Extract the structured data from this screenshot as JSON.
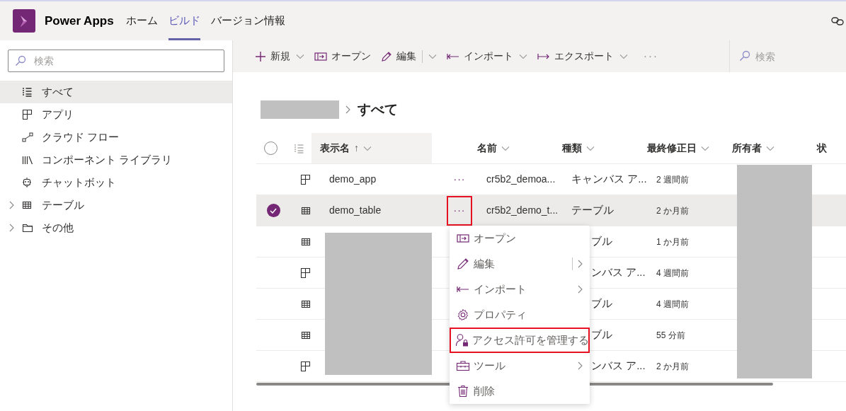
{
  "app": {
    "title": "Power Apps"
  },
  "nav_tabs": [
    {
      "label": "ホーム",
      "selected": false
    },
    {
      "label": "ビルド",
      "selected": true
    },
    {
      "label": "バージョン情報",
      "selected": false
    }
  ],
  "sidebar": {
    "search": {
      "placeholder": "検索"
    },
    "items": [
      {
        "label": "すべて",
        "selected": true
      },
      {
        "label": "アプリ",
        "selected": false
      },
      {
        "label": "クラウド フロー",
        "selected": false
      },
      {
        "label": "コンポーネント ライブラリ",
        "selected": false
      },
      {
        "label": "チャットボット",
        "selected": false
      },
      {
        "label": "テーブル",
        "selected": false,
        "expanded": false
      },
      {
        "label": "その他",
        "selected": false,
        "expanded": false
      }
    ]
  },
  "toolbar": {
    "items": [
      {
        "label": "新規",
        "dropdown": true
      },
      {
        "label": "オープン",
        "dropdown": false
      },
      {
        "label": "編集",
        "dropdown": true
      },
      {
        "label": "インポート",
        "dropdown": true
      },
      {
        "label": "エクスポート",
        "dropdown": true
      }
    ],
    "overflow": "···",
    "search": {
      "placeholder": "検索"
    }
  },
  "breadcrumb": {
    "current": "すべて"
  },
  "table": {
    "select_all": {
      "checked": false
    },
    "columns": [
      {
        "label": "表示名",
        "sort": "↑"
      },
      {
        "label": "名前"
      },
      {
        "label": "種類"
      },
      {
        "label": "最終修正日"
      },
      {
        "label": "所有者"
      },
      {
        "label": "状"
      }
    ],
    "rows": [
      {
        "kind": "app",
        "selected": false,
        "display_name": "demo_app",
        "more": "···",
        "highlighted": false,
        "name": "cr5b2_demoa...",
        "type": "キャンバス ア...",
        "modified": "2 週間前"
      },
      {
        "kind": "table",
        "selected": true,
        "display_name": "demo_table",
        "more": "···",
        "highlighted": true,
        "name": "cr5b2_demo_t...",
        "type": "テーブル",
        "modified": "2 か月前"
      },
      {
        "kind": "table",
        "selected": false,
        "type": "ブル",
        "modified": "1 か月前"
      },
      {
        "kind": "app",
        "selected": false,
        "type": "ンバス ア...",
        "modified": "4 週間前"
      },
      {
        "kind": "table",
        "selected": false,
        "type": "ブル",
        "modified": "4 週間前"
      },
      {
        "kind": "table",
        "selected": false,
        "type": "ブル",
        "modified": "55 分前"
      },
      {
        "kind": "app",
        "selected": false,
        "type": "ンバス ア...",
        "modified": "2 か月前"
      }
    ]
  },
  "context_menu": {
    "items": [
      {
        "label": "オープン",
        "submenu": false,
        "split": false,
        "highlighted": false
      },
      {
        "label": "編集",
        "submenu": true,
        "split": true,
        "highlighted": false
      },
      {
        "label": "インポート",
        "submenu": true,
        "split": false,
        "highlighted": false
      },
      {
        "label": "プロパティ",
        "submenu": false,
        "split": false,
        "highlighted": false
      },
      {
        "label": "アクセス許可を管理する",
        "submenu": false,
        "split": false,
        "highlighted": true
      },
      {
        "label": "ツール",
        "submenu": true,
        "split": false,
        "highlighted": false
      },
      {
        "label": "削除",
        "submenu": false,
        "split": false,
        "highlighted": false
      }
    ]
  }
}
